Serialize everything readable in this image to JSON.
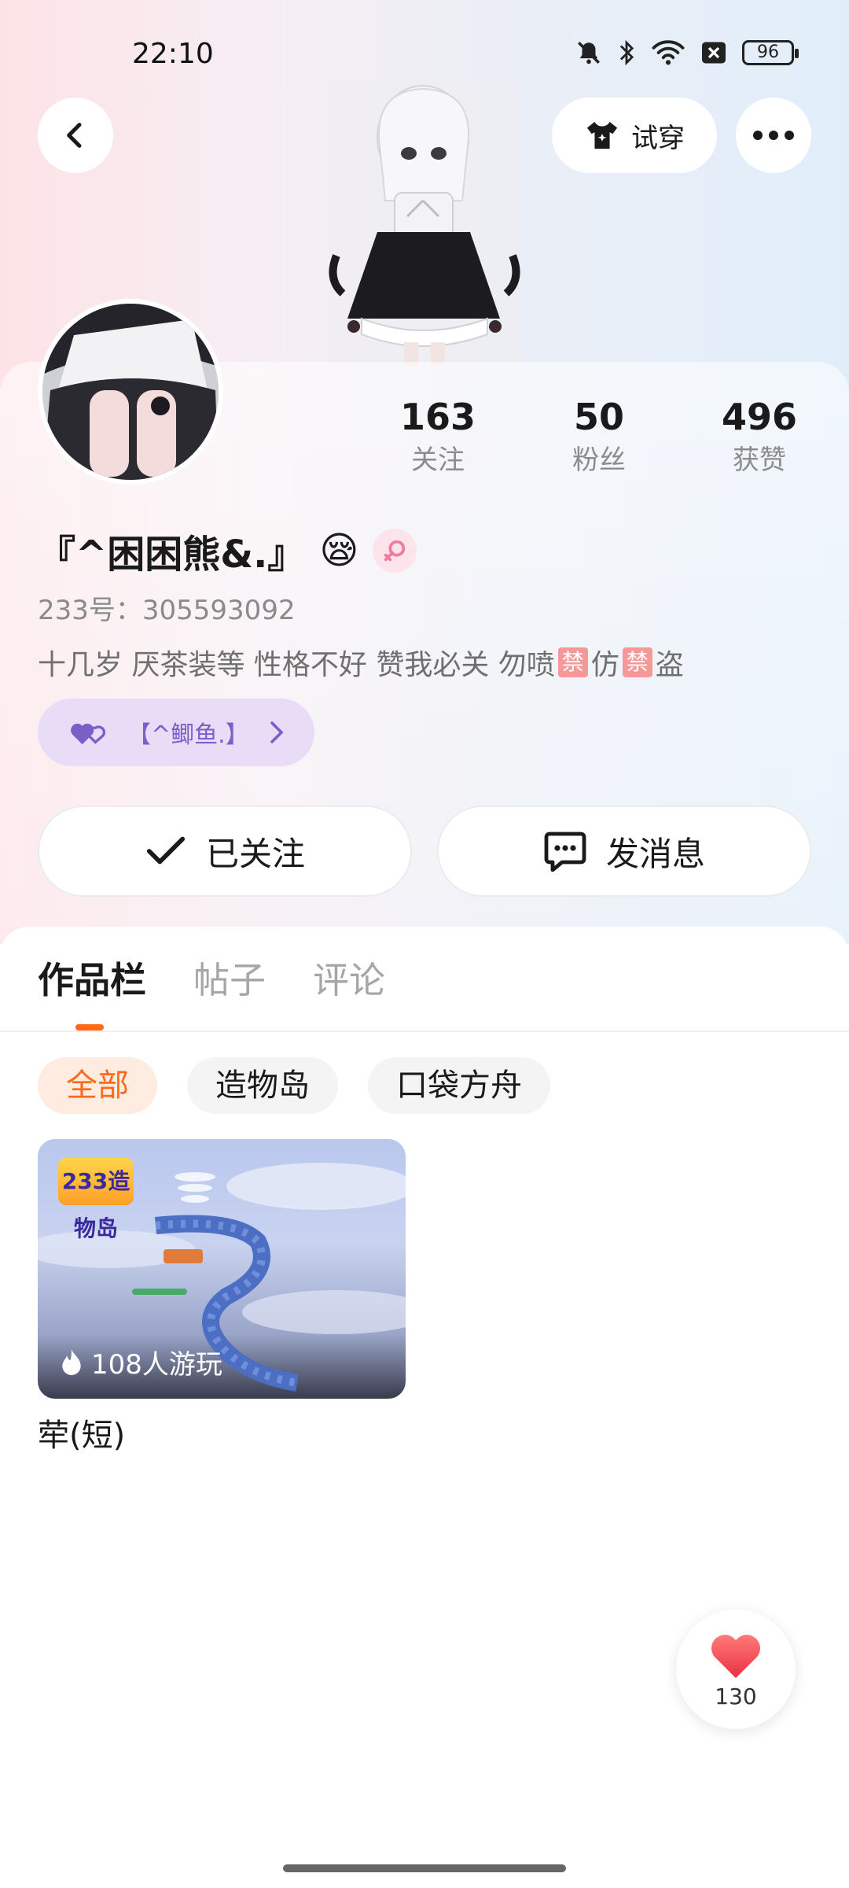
{
  "status_bar": {
    "time": "22:10",
    "battery": "96"
  },
  "header": {
    "try_on_label": "试穿"
  },
  "stats": [
    {
      "value": "163",
      "label": "关注"
    },
    {
      "value": "50",
      "label": "粉丝"
    },
    {
      "value": "496",
      "label": "获赞"
    }
  ],
  "profile": {
    "nickname": "『^困困熊&.』",
    "status_emoji": "😪",
    "uid_text": "233号：305593092",
    "bio_parts": [
      "十几岁 厌茶装等 性格不好 赞我必关 勿喷 ",
      "禁",
      "仿 ",
      "禁",
      "盗"
    ],
    "cp_name": "【^鲫鱼.】"
  },
  "actions": {
    "follow_label": "已关注",
    "message_label": "发消息"
  },
  "tabs": [
    "作品栏",
    "帖子",
    "评论"
  ],
  "filters": [
    "全部",
    "造物岛",
    "口袋方舟"
  ],
  "works": [
    {
      "badge": "233造物岛",
      "play_count": "108人游玩",
      "title": "荦(短)"
    }
  ],
  "like_fab": {
    "count": "130"
  },
  "colors": {
    "accent": "#ff6a1a",
    "cp_purple": "#7a5fc9",
    "heart": "#f03e4f"
  }
}
